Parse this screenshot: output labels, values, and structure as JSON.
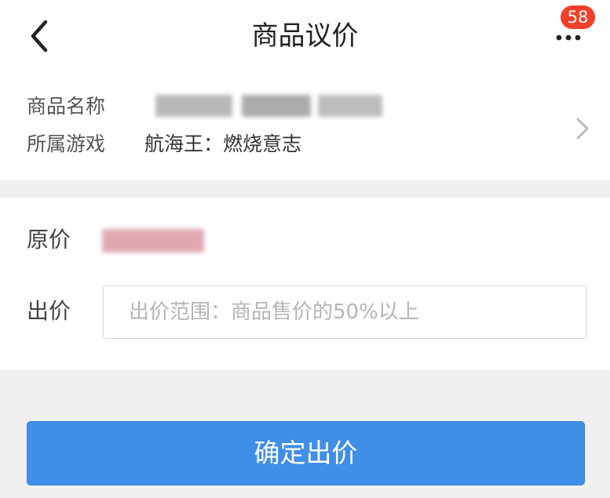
{
  "header": {
    "title": "商品议价",
    "back_icon": "chevron-left-icon",
    "more_icon": "more-dots-icon",
    "badge_count": "58",
    "badge_color": "#f43f2b"
  },
  "product": {
    "name_label": "商品名称",
    "game_label": "所属游戏",
    "game_value": "航海王：燃烧意志",
    "detail_icon": "chevron-right-icon"
  },
  "offer_form": {
    "original_price_label": "原价",
    "offer_label": "出价",
    "offer_placeholder": "出价范围：商品售价的50%以上",
    "offer_value": ""
  },
  "actions": {
    "submit_label": "确定出价",
    "submit_color": "#3f8ee8"
  }
}
